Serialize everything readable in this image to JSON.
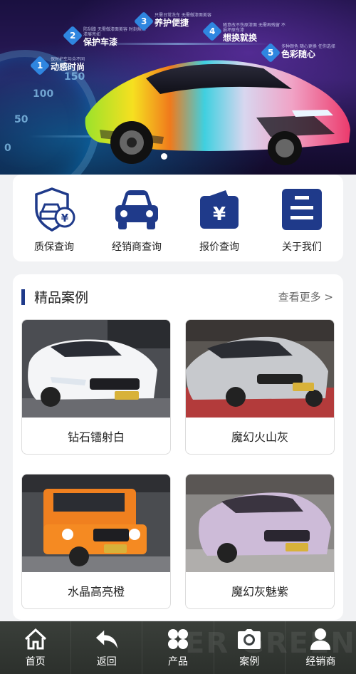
{
  "hero": {
    "features": [
      {
        "num": "1",
        "desc": "保时护车与众不同",
        "title": "动感时尚"
      },
      {
        "num": "2",
        "desc": "防刮蹭 无需做漆面美容 时刻焕车漆展亮如",
        "title": "保护车漆"
      },
      {
        "num": "3",
        "desc": "只需日常洗车 无需做漆面美容",
        "title": "养护便捷"
      },
      {
        "num": "4",
        "desc": "随意改不伤原漆面 无需再残留 不损坏原车漆",
        "title": "想换就换"
      },
      {
        "num": "5",
        "desc": "多种颜色 随心更换 任你选择",
        "title": "色彩随心"
      }
    ],
    "speedometer": [
      "0",
      "50",
      "100",
      "150"
    ]
  },
  "quick_nav": [
    {
      "label": "质保查询",
      "icon": "car-warranty-shield-icon"
    },
    {
      "label": "经销商查询",
      "icon": "car-front-icon"
    },
    {
      "label": "报价查询",
      "icon": "wallet-yen-icon"
    },
    {
      "label": "关于我们",
      "icon": "info-list-icon"
    }
  ],
  "cases": {
    "title": "精品案例",
    "more": "查看更多 >",
    "items": [
      {
        "name": "钻石镭射白"
      },
      {
        "name": "魔幻火山灰"
      },
      {
        "name": "水晶高亮橙"
      },
      {
        "name": "魔幻灰魅紫"
      }
    ]
  },
  "tabbar": {
    "items": [
      {
        "label": "首页",
        "icon": "home-icon"
      },
      {
        "label": "返回",
        "icon": "back-arrow-icon"
      },
      {
        "label": "产品",
        "icon": "grid-flower-icon"
      },
      {
        "label": "案例",
        "icon": "camera-icon"
      },
      {
        "label": "经销商",
        "icon": "user-icon"
      }
    ]
  },
  "colors": {
    "primary": "#1f3a8a",
    "tab_bg": "#34393a",
    "page_bg": "#f1f2f4"
  }
}
